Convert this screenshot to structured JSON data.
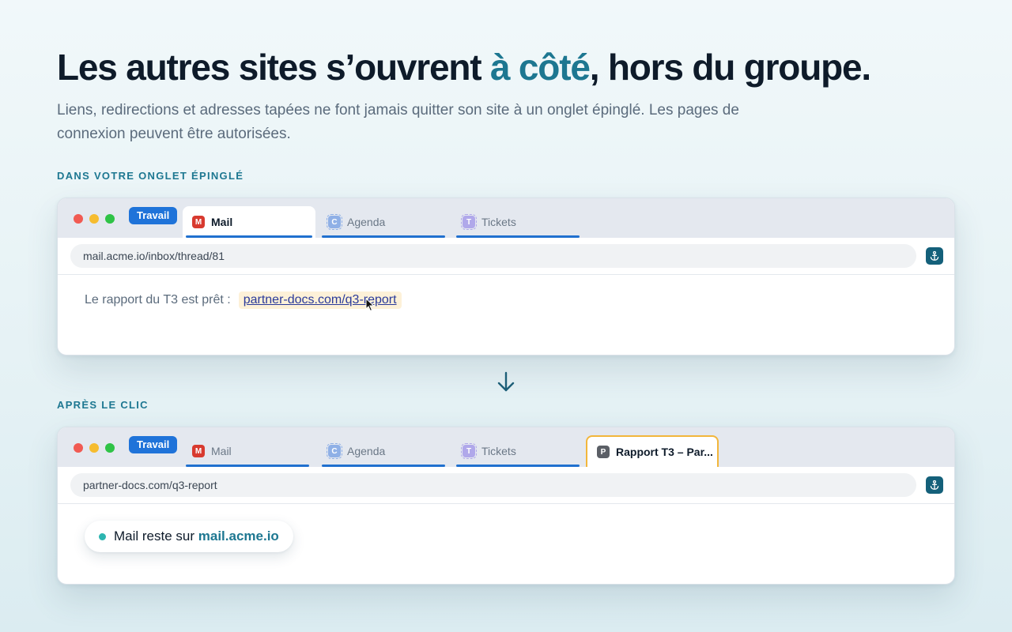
{
  "headline": {
    "before": "Les autres sites s’ouvrent ",
    "accent": "à côté",
    "after": ", hors du groupe."
  },
  "subtitle": "Liens, redirections et adresses tapées ne font jamais quitter son site à un onglet épinglé. Les pages de connexion peuvent être autorisées.",
  "colors": {
    "accent": "#1d7791",
    "group_chip": "#1f73d9",
    "tab_underline": "#2070cf",
    "new_tab_border": "#f2b63b",
    "link_highlight": "#fdf1d8",
    "status_dot": "#2cb5b0"
  },
  "before": {
    "label": "DANS VOTRE ONGLET ÉPINGLÉ",
    "group": "Travail",
    "tabs": [
      {
        "icon": "M",
        "label": "Mail"
      },
      {
        "icon": "C",
        "label": "Agenda"
      },
      {
        "icon": "T",
        "label": "Tickets"
      }
    ],
    "url": "mail.acme.io/inbox/thread/81",
    "anchor_icon": "anchor-icon",
    "message": "Le rapport du T3 est prêt :",
    "link": "partner-docs.com/q3-report"
  },
  "after": {
    "label": "APRÈS LE CLIC",
    "group": "Travail",
    "tabs": [
      {
        "icon": "M",
        "label": "Mail"
      },
      {
        "icon": "C",
        "label": "Agenda"
      },
      {
        "icon": "T",
        "label": "Tickets"
      },
      {
        "icon": "P",
        "label": "Rapport T3 – Par..."
      }
    ],
    "url": "partner-docs.com/q3-report",
    "anchor_icon": "anchor-icon",
    "status_prefix": "Mail reste sur ",
    "status_domain": "mail.acme.io"
  }
}
